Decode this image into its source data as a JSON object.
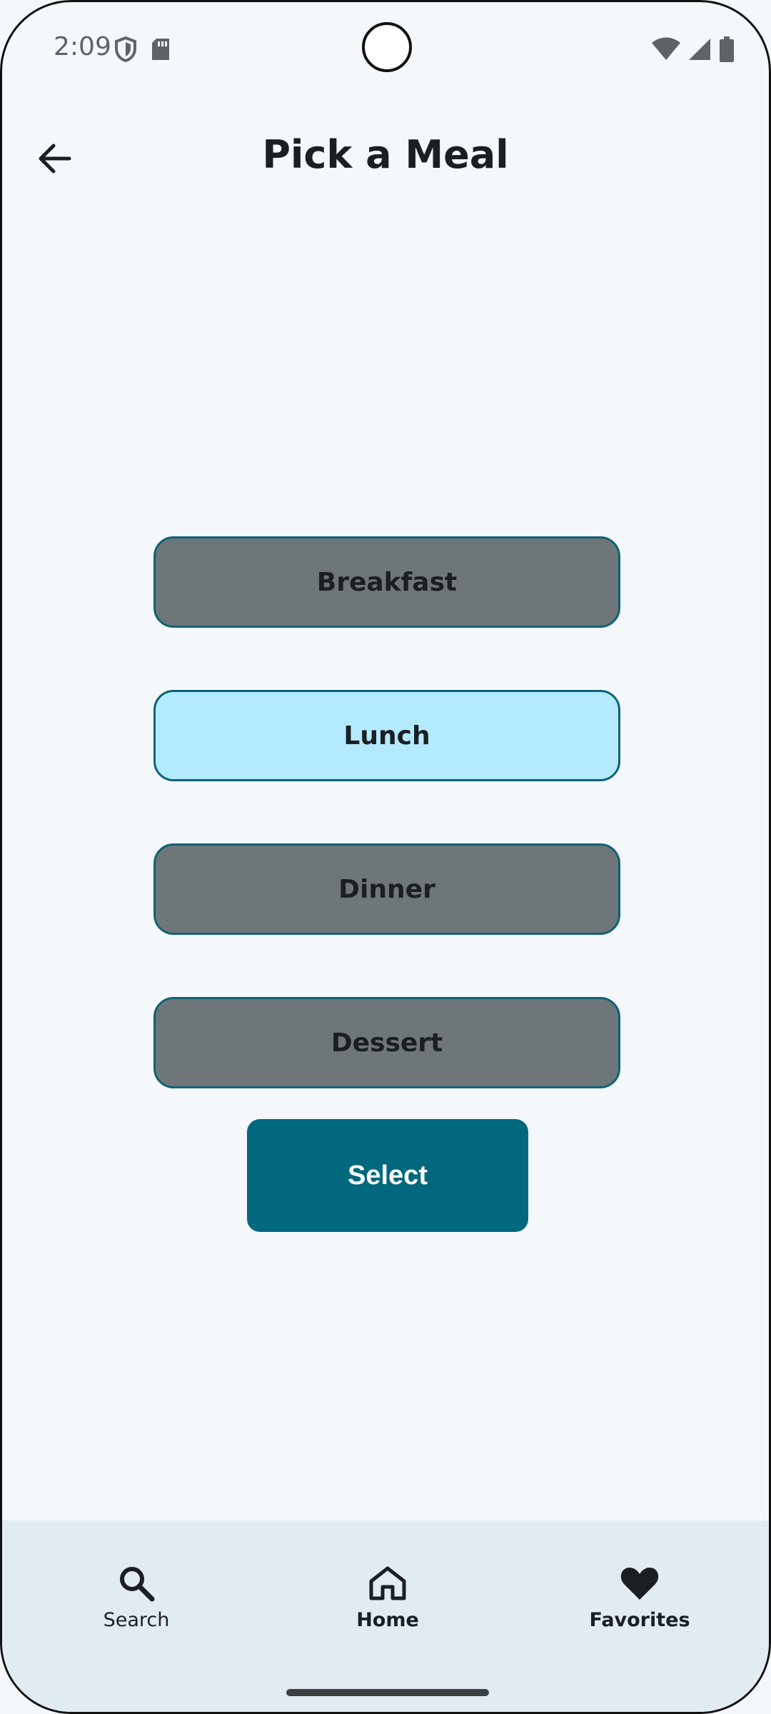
{
  "status_bar": {
    "time": "2:09",
    "icons": [
      "shield-icon",
      "sd-card-icon",
      "wifi-icon",
      "signal-icon",
      "battery-icon"
    ]
  },
  "header": {
    "title": "Pick a Meal",
    "back_icon": "arrow-left-icon"
  },
  "meal_options": [
    {
      "label": "Breakfast",
      "selected": false
    },
    {
      "label": "Lunch",
      "selected": true
    },
    {
      "label": "Dinner",
      "selected": false
    },
    {
      "label": "Dessert",
      "selected": false
    }
  ],
  "colors": {
    "background": "#f4f8fb",
    "option_default": "#6f7679",
    "option_selected": "#b3eafd",
    "option_border": "#0f6278",
    "primary": "#01687d",
    "nav_background": "#e0ecf2"
  },
  "select_button": {
    "label": "Select"
  },
  "bottom_nav": {
    "items": [
      {
        "label": "Search",
        "icon": "search-icon",
        "bold": false
      },
      {
        "label": "Home",
        "icon": "home-icon",
        "bold": true
      },
      {
        "label": "Favorites",
        "icon": "heart-icon",
        "bold": true
      }
    ]
  }
}
